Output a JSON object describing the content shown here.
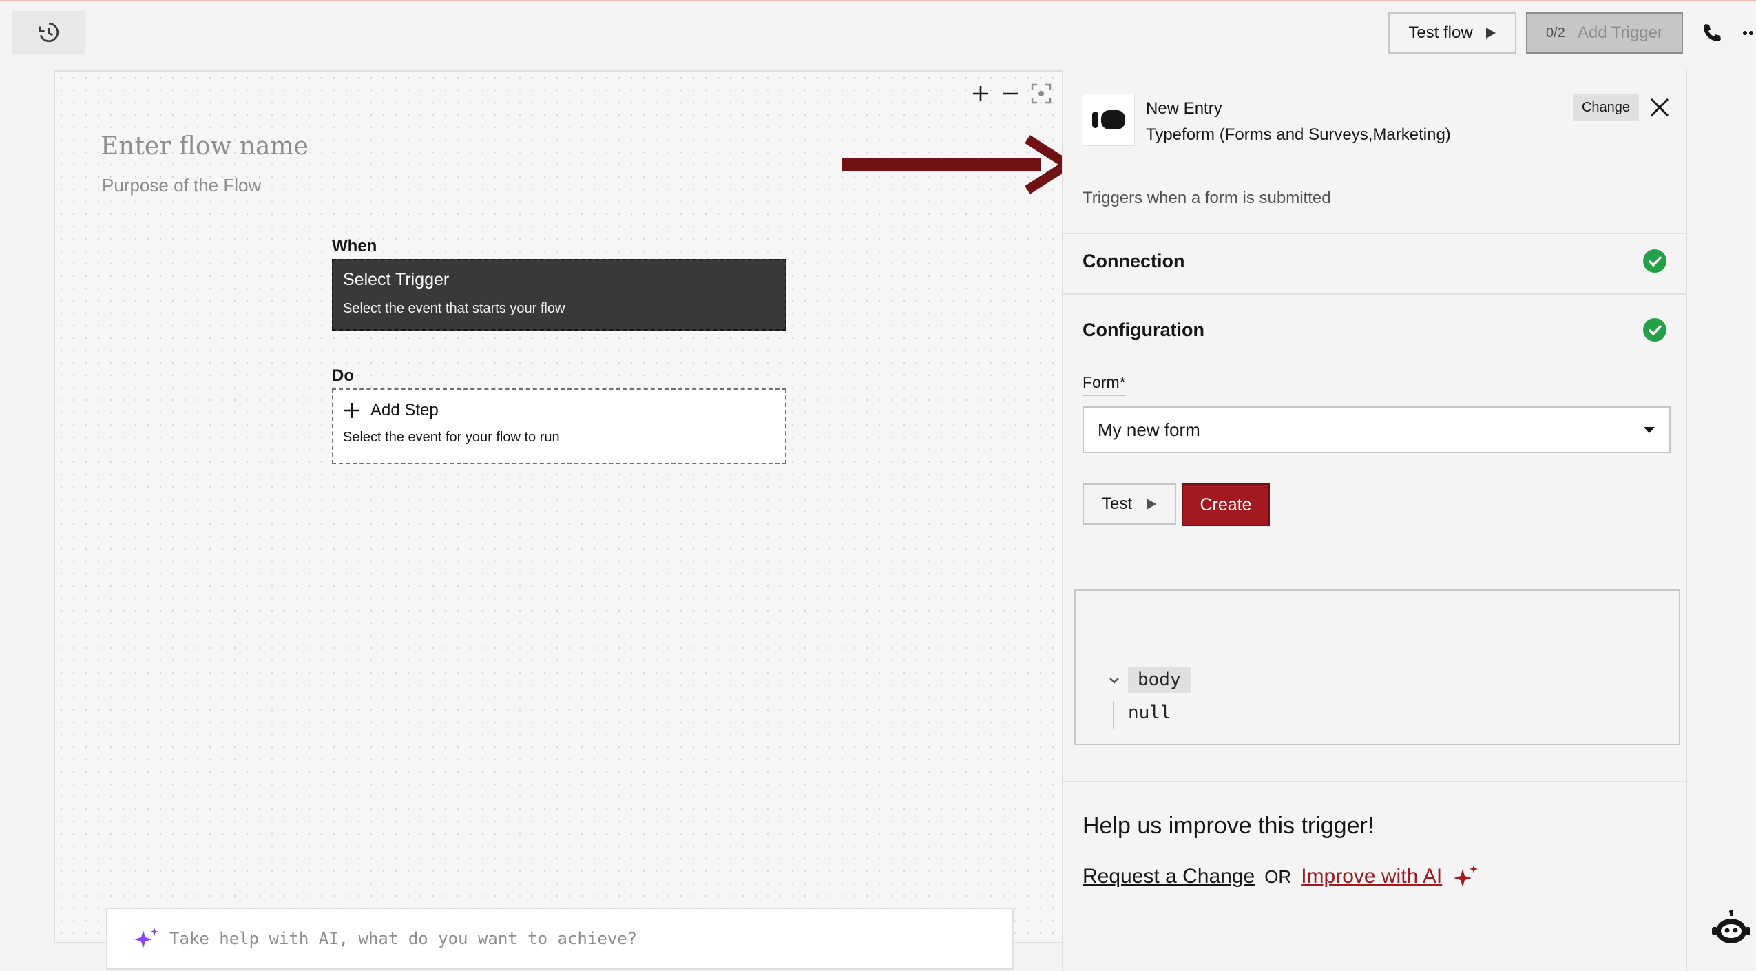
{
  "topbar": {
    "history_icon": "history-icon",
    "test_flow_label": "Test flow",
    "trigger_count": "0/2",
    "add_trigger_label": "Add Trigger",
    "phone_icon": "phone-icon",
    "more_icon": "more-icon"
  },
  "canvas": {
    "flow_name_placeholder": "Enter flow name",
    "flow_purpose_placeholder": "Purpose of the Flow",
    "when_label": "When",
    "trigger_title": "Select Trigger",
    "trigger_subtitle": "Select the event that starts your flow",
    "do_label": "Do",
    "add_step_label": "Add Step",
    "add_step_subtitle": "Select the event for your flow to run",
    "ai_placeholder": "Take help with AI, what do you want to achieve?",
    "zoom_icons": [
      "zoom-in-icon",
      "zoom-out-icon",
      "fit-view-icon"
    ]
  },
  "panel": {
    "trigger_name": "New Entry",
    "app_name": "Typeform (Forms and Surveys,Marketing)",
    "change_label": "Change",
    "description": "Triggers when a form is submitted",
    "connection_title": "Connection",
    "configuration_title": "Configuration",
    "form_label": "Form*",
    "form_value": "My new form",
    "test_label": "Test",
    "create_label": "Create",
    "json_key": "body",
    "json_value": "null",
    "help_title": "Help us improve this trigger!",
    "request_change_label": "Request a Change",
    "or_label": "OR",
    "improve_ai_label": "Improve with AI"
  },
  "colors": {
    "primary_red": "#a2191f",
    "success_green": "#24a148",
    "dark_trigger": "#393939",
    "arrow": "#6f1115",
    "ai_purple": "#8a3ffc"
  }
}
